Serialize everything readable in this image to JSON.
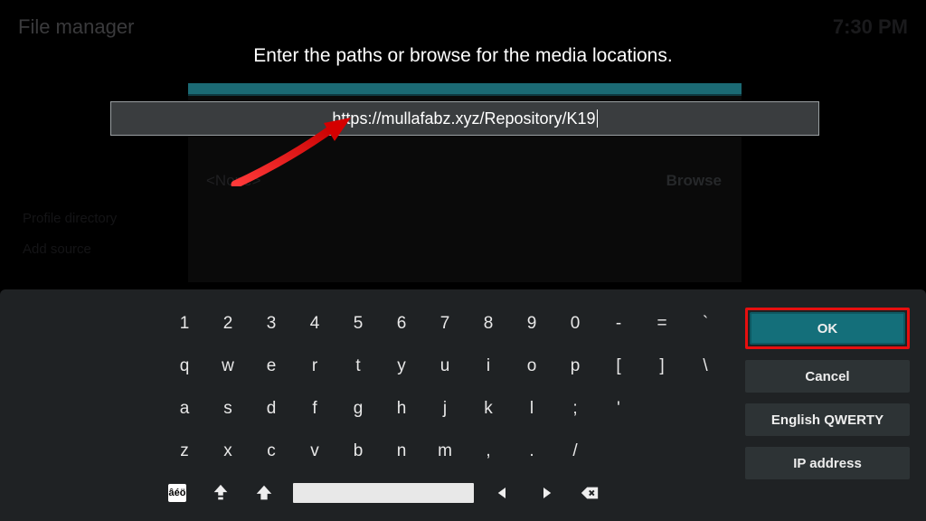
{
  "header": {
    "title": "File manager",
    "clock": "7:30 PM"
  },
  "dialog": {
    "prompt": "Enter the paths or browse for the media locations.",
    "input_value": "https://mullafabz.xyz/Repository/K19",
    "none_label": "<None>",
    "browse_label": "Browse"
  },
  "sidebar_items": [
    "Profile directory",
    "Add source"
  ],
  "keyboard": {
    "row1": [
      "1",
      "2",
      "3",
      "4",
      "5",
      "6",
      "7",
      "8",
      "9",
      "0",
      "-",
      "=",
      "`"
    ],
    "row2": [
      "q",
      "w",
      "e",
      "r",
      "t",
      "y",
      "u",
      "i",
      "o",
      "p",
      "[",
      "]",
      "\\"
    ],
    "row3": [
      "a",
      "s",
      "d",
      "f",
      "g",
      "h",
      "j",
      "k",
      "l",
      ";",
      "'"
    ],
    "row4": [
      "z",
      "x",
      "c",
      "v",
      "b",
      "n",
      "m",
      ",",
      ".",
      "/"
    ],
    "bottom_accent": "âéö"
  },
  "actions": {
    "ok": "OK",
    "cancel": "Cancel",
    "layout": "English QWERTY",
    "ip": "IP address"
  }
}
